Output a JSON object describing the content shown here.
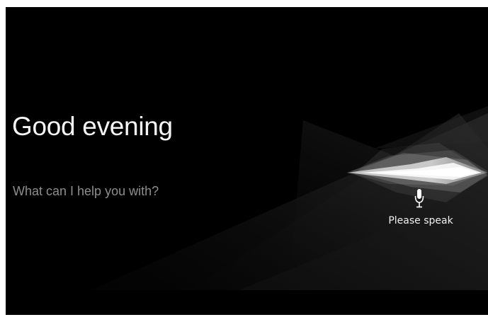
{
  "assistant": {
    "greeting": "Good evening",
    "prompt": "What can I help you with?",
    "status_label": "Please speak"
  },
  "icons": {
    "microphone": "microphone-icon",
    "voice_wave": "voice-waveform"
  },
  "colors": {
    "background": "#000000",
    "greeting_text": "#f4f4f4",
    "prompt_text": "#8e8e8e",
    "status_text": "#f0f0f0"
  }
}
